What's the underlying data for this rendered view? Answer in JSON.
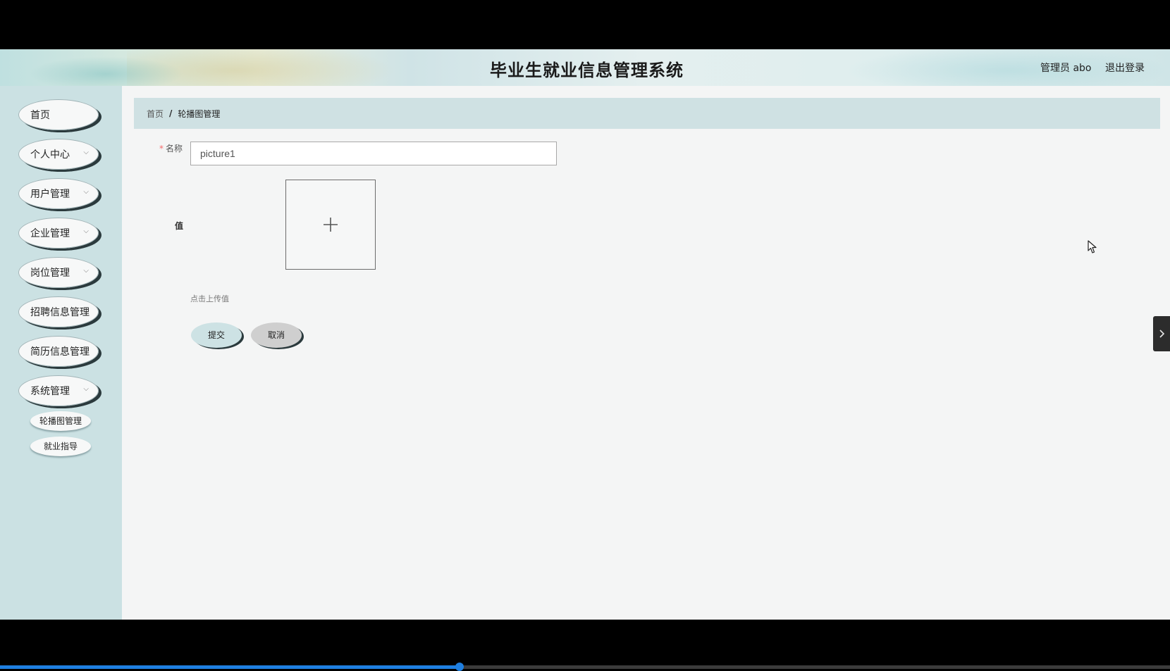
{
  "header": {
    "title": "毕业生就业信息管理系统",
    "user_label": "管理员 abo",
    "logout_label": "退出登录"
  },
  "sidebar": {
    "items": [
      {
        "label": "首页",
        "has_children": false
      },
      {
        "label": "个人中心",
        "has_children": true
      },
      {
        "label": "用户管理",
        "has_children": true
      },
      {
        "label": "企业管理",
        "has_children": true
      },
      {
        "label": "岗位管理",
        "has_children": true
      },
      {
        "label": "招聘信息管理",
        "has_children": false
      },
      {
        "label": "简历信息管理",
        "has_children": false
      },
      {
        "label": "系统管理",
        "has_children": true
      }
    ],
    "sub_items": [
      {
        "label": "轮播图管理"
      },
      {
        "label": "就业指导"
      }
    ]
  },
  "breadcrumb": {
    "home": "首页",
    "separator": "/",
    "current": "轮播图管理"
  },
  "form": {
    "name_label": "名称",
    "name_value": "picture1",
    "value_label": "值",
    "upload_tip": "点击上传值",
    "submit_label": "提交",
    "cancel_label": "取消"
  },
  "icons": {
    "upload": "plus-icon",
    "nav_expand": "chevron-down-icon",
    "side_toggle": "chevron-right-icon",
    "cursor": "mouse-pointer-icon"
  },
  "colors": {
    "sidebar_bg": "#cbe1e3",
    "breadcrumb_bg": "#cfe1e3",
    "required": "#f56c6c",
    "video_progress": "#1f7fe0"
  },
  "video_progress": 0.393
}
